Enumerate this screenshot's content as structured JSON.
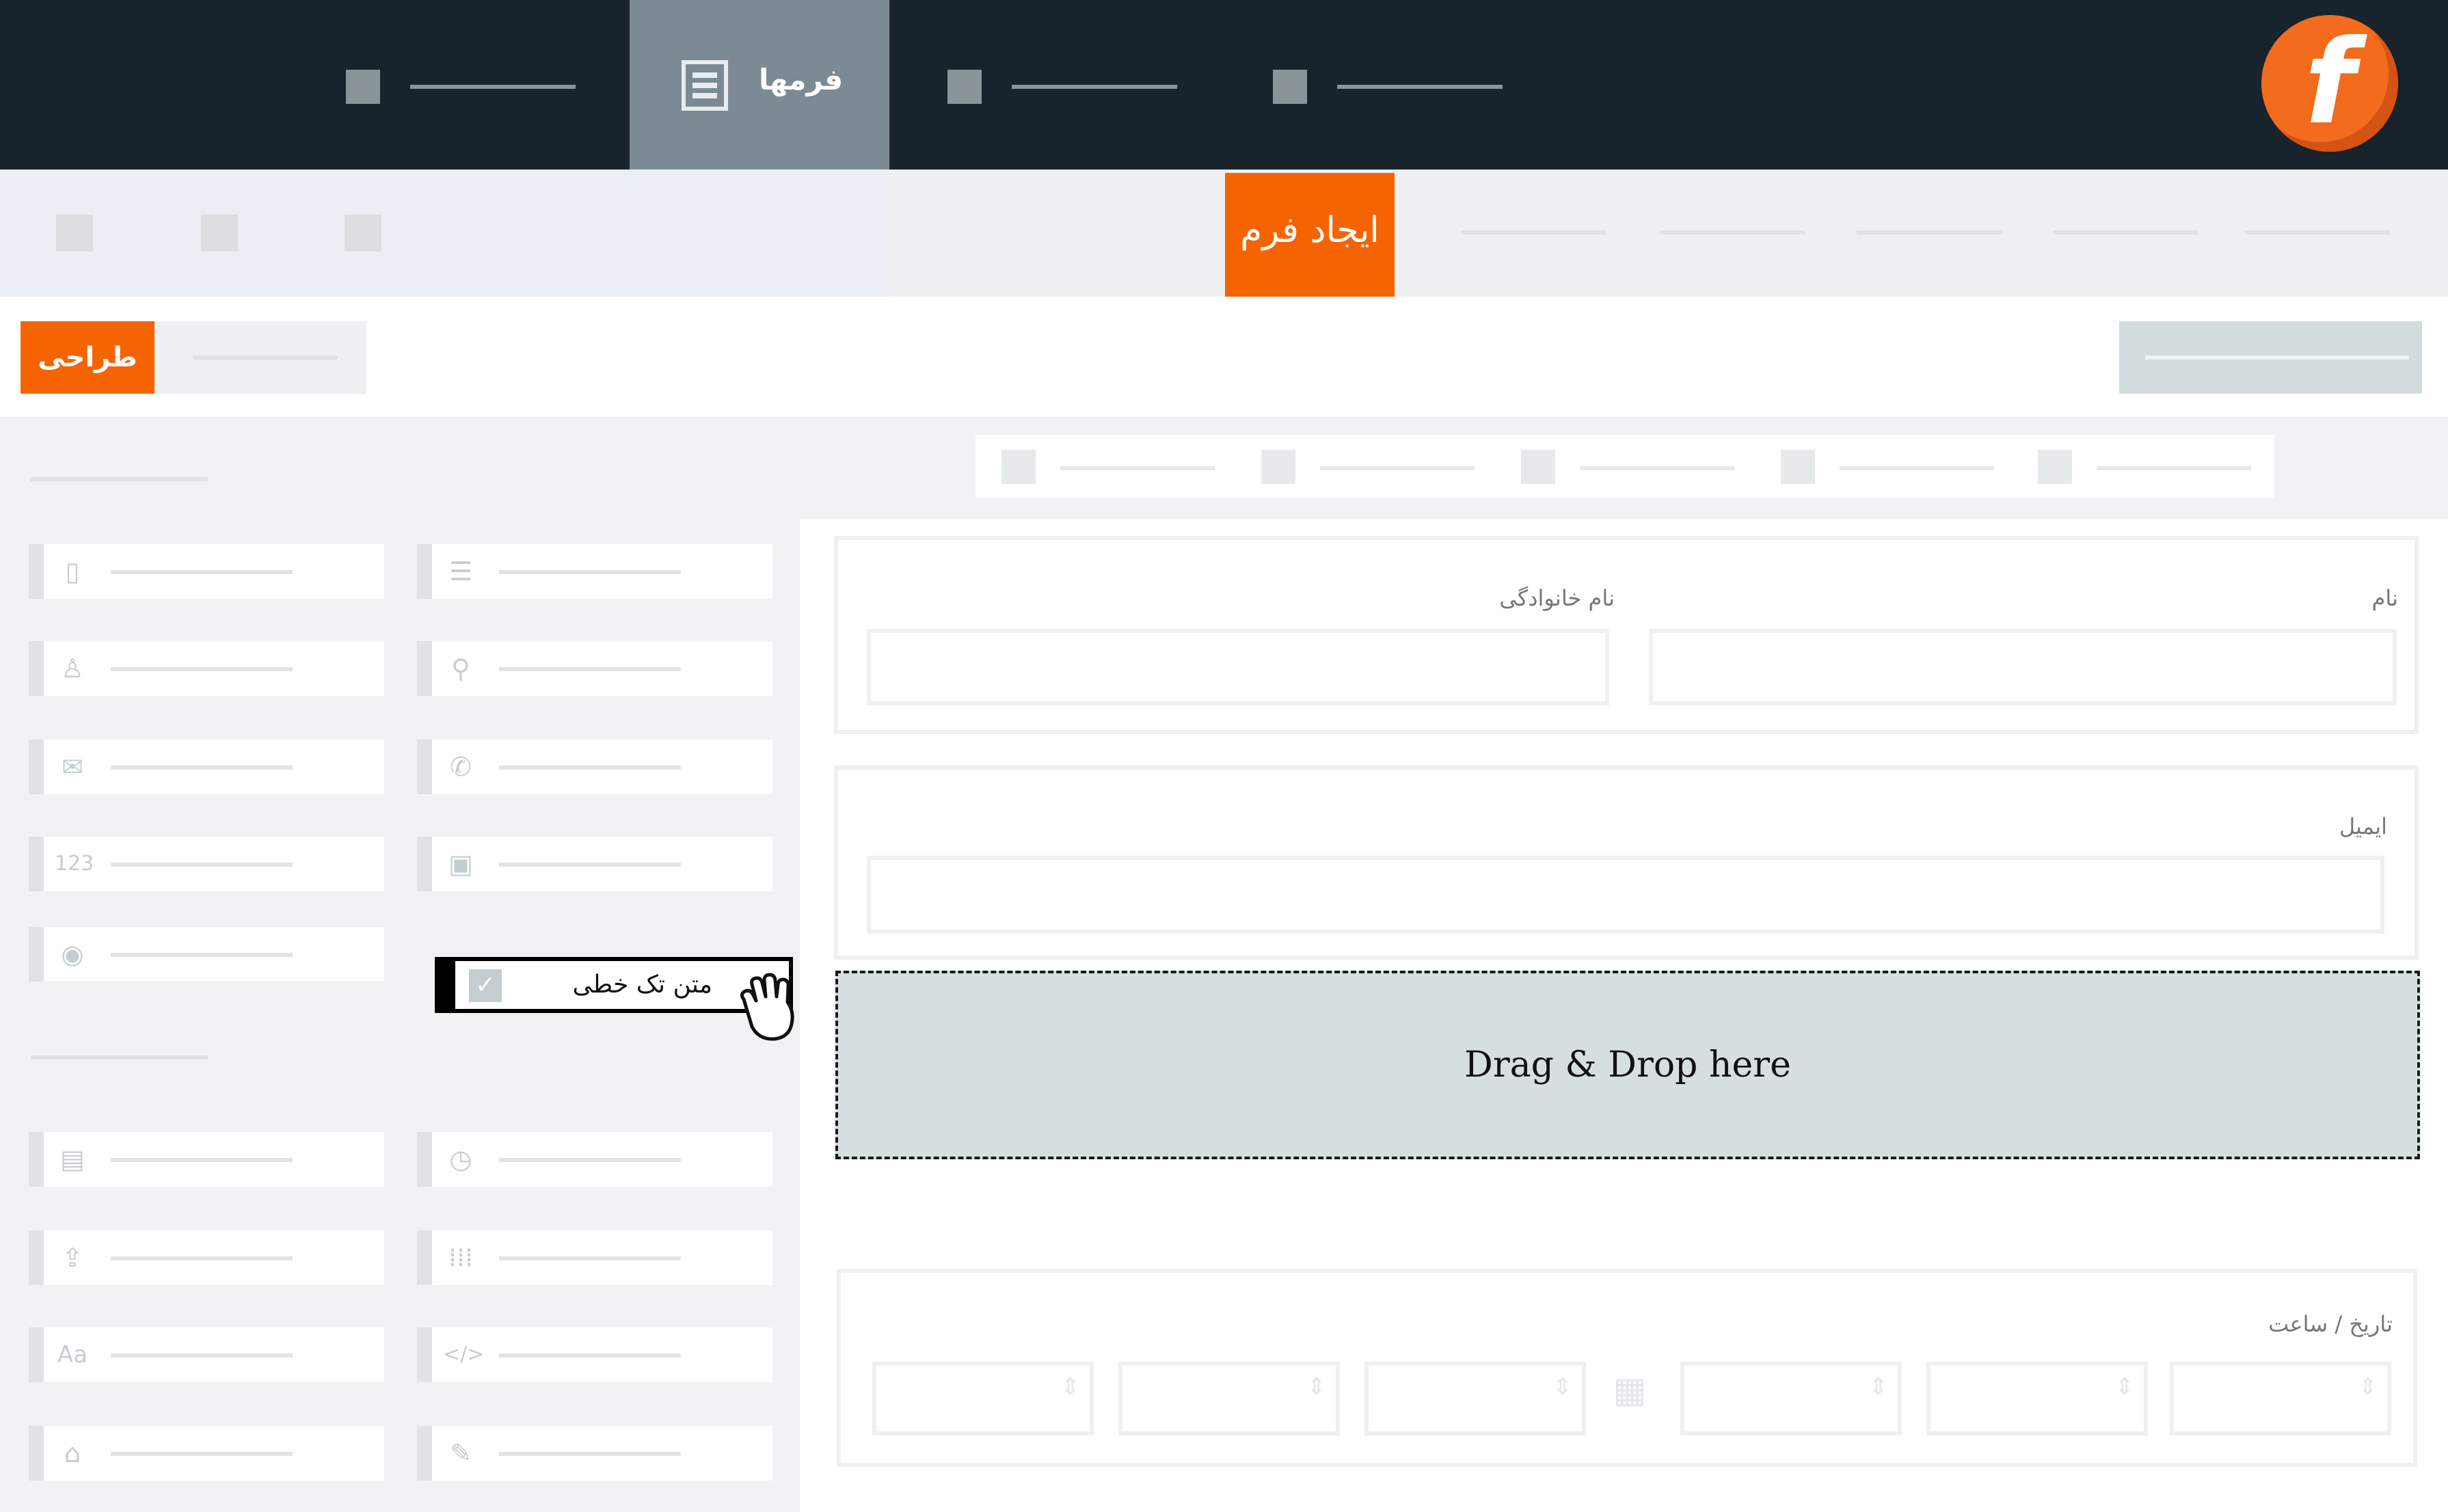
{
  "header": {
    "active_tab_label": "فرمها"
  },
  "subheader": {
    "create_form_label": "ایجاد فرم"
  },
  "toolbar": {
    "design_label": "طراحی"
  },
  "palette": {
    "dragging_item_label": "متن تک خطی",
    "icons": [
      "column-icon",
      "list-icon",
      "user-icon",
      "location-icon",
      "email-icon",
      "phone-icon",
      "number-icon",
      "dropdown-icon",
      "radio-icon",
      "checkbox-icon",
      "card-icon",
      "clock-icon",
      "upload-icon",
      "grid-icon",
      "text-icon",
      "code-icon",
      "tag-icon",
      "pen-icon"
    ]
  },
  "form": {
    "first_name_label": "نام",
    "last_name_label": "نام خانوادگی",
    "email_label": "ایمیل",
    "dropzone_text": "Drag & Drop here",
    "datetime_label": "تاریخ / ساعت"
  },
  "colors": {
    "accent": "#f56400",
    "header_bg": "#18232b",
    "active_tab_bg": "#7b8a93",
    "dropzone_bg": "#d6dfdf"
  }
}
